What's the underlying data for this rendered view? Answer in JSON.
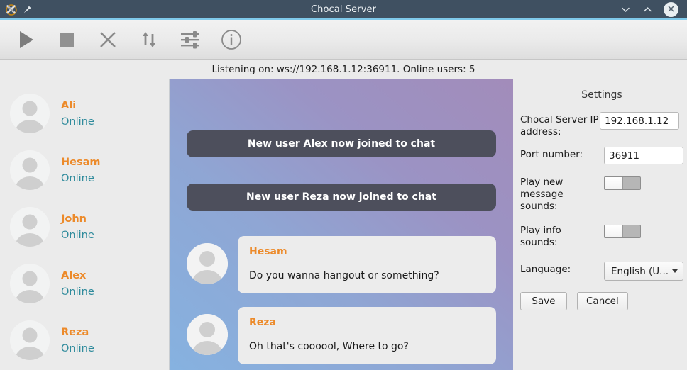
{
  "window": {
    "title": "Chocal Server",
    "logo_icon": "chocal-logo-icon",
    "pin_icon": "pin-icon",
    "minimize_icon": "chevron-down-icon",
    "maximize_icon": "chevron-up-icon",
    "close_icon": "close-circle-icon",
    "accent_color": "#7fc9ea",
    "titlebar_color": "#3f5061"
  },
  "toolbar": {
    "buttons": [
      {
        "name": "start-server-button",
        "icon": "play-icon"
      },
      {
        "name": "stop-server-button",
        "icon": "stop-square-icon"
      },
      {
        "name": "close-server-button",
        "icon": "x-icon"
      },
      {
        "name": "transfer-button",
        "icon": "up-down-arrows-icon"
      },
      {
        "name": "settings-button",
        "icon": "sliders-icon"
      },
      {
        "name": "info-button",
        "icon": "info-circle-icon"
      }
    ]
  },
  "status": {
    "text": "Listening on: ws://192.168.1.12:36911. Online users: 5"
  },
  "users": {
    "name_color": "#ec8a2a",
    "status_color": "#2f8b9c",
    "items": [
      {
        "name": "Ali",
        "status": "Online"
      },
      {
        "name": "Hesam",
        "status": "Online"
      },
      {
        "name": "John",
        "status": "Online"
      },
      {
        "name": "Alex",
        "status": "Online"
      },
      {
        "name": "Reza",
        "status": "Online"
      }
    ]
  },
  "chat": {
    "messages": [
      {
        "type": "system",
        "text": "New user Alex now joined to chat"
      },
      {
        "type": "system",
        "text": "New user Reza now joined to chat"
      },
      {
        "type": "user",
        "sender": "Hesam",
        "text": "Do you wanna hangout or something?"
      },
      {
        "type": "user",
        "sender": "Reza",
        "text": "Oh that's coooool, Where to go?"
      }
    ]
  },
  "settings": {
    "title": "Settings",
    "ip_label": "Chocal Server IP address:",
    "ip_value": "192.168.1.12",
    "ip_placeholder": "192.168.1.12",
    "port_label": "Port number:",
    "port_value": "36911",
    "port_placeholder": "36911",
    "msg_sounds_label": "Play new message sounds:",
    "msg_sounds_state": "off",
    "info_sounds_label": "Play info sounds:",
    "info_sounds_state": "off",
    "language_label": "Language:",
    "language_value": "English (U...",
    "save_label": "Save",
    "cancel_label": "Cancel"
  }
}
